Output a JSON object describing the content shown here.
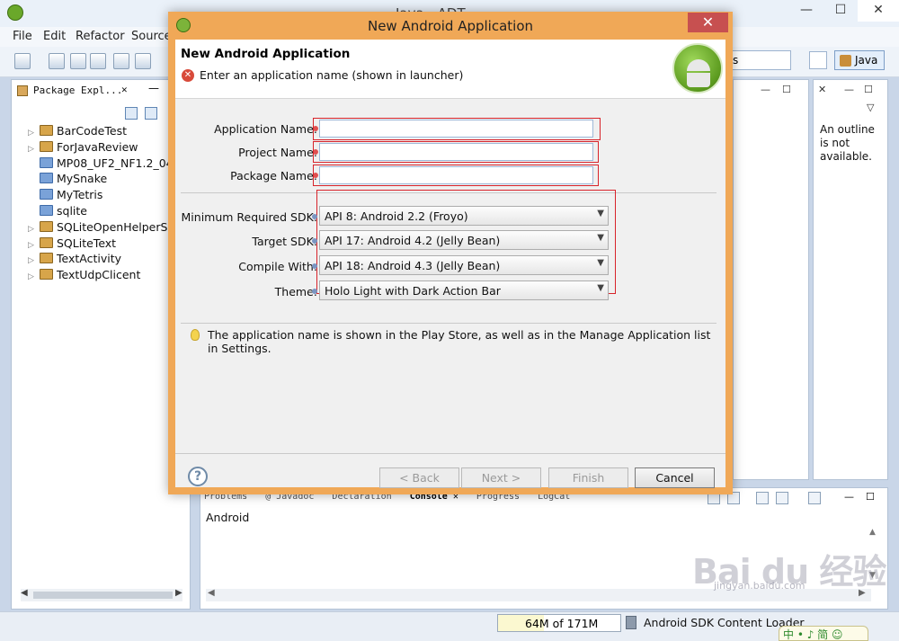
{
  "ide": {
    "title": "Java - ADT",
    "menu": [
      "File",
      "Edit",
      "Refactor",
      "Source"
    ],
    "search_value": "s",
    "perspective": "Java",
    "controls": {
      "minimize": "—",
      "maximize": "☐",
      "close": "✕"
    }
  },
  "package_explorer": {
    "tab_label": "Package Expl...",
    "close": "✕",
    "minimize": "—",
    "items": [
      {
        "label": "BarCodeTest",
        "expandable": true,
        "type": "android"
      },
      {
        "label": "ForJavaReview",
        "expandable": true,
        "type": "android"
      },
      {
        "label": "MP08_UF2_NF1.2_04",
        "expandable": false,
        "type": "folder"
      },
      {
        "label": "MySnake",
        "expandable": false,
        "type": "folder"
      },
      {
        "label": "MyTetris",
        "expandable": false,
        "type": "folder"
      },
      {
        "label": "sqlite",
        "expandable": false,
        "type": "folder"
      },
      {
        "label": "SQLiteOpenHelperSar",
        "expandable": true,
        "type": "android"
      },
      {
        "label": "SQLiteText",
        "expandable": true,
        "type": "android"
      },
      {
        "label": "TextActivity",
        "expandable": true,
        "type": "android"
      },
      {
        "label": "TextUdpClicent",
        "expandable": true,
        "type": "android"
      }
    ]
  },
  "outline": {
    "close": "✕",
    "minimize": "—",
    "maximize": "☐",
    "menu": "▽",
    "message": "An outline is not available."
  },
  "editor_controls": {
    "minimize": "—",
    "maximize": "☐"
  },
  "console": {
    "tabs": [
      "Problems",
      "@ Javadoc",
      "Declaration",
      "Console ✕",
      "Progress",
      "LogCat"
    ],
    "active_tab": "Console ✕",
    "label": "Android",
    "scroll_up": "▲",
    "scroll_down": "▼",
    "scroll_left": "◀",
    "scroll_right": "▶",
    "minimize": "—",
    "maximize": "☐"
  },
  "status": {
    "heap": "64M of 171M",
    "heap_used_fraction": 0.374,
    "task": "Android SDK Content Loader",
    "ime": "中 • ♪ 简 ☺"
  },
  "watermark": {
    "brand": "Bai du 经验",
    "url": "jingyan.baidu.com"
  },
  "dialog": {
    "title": "New Android Application",
    "close": "✕",
    "heading": "New Android Application",
    "error_icon": "✕",
    "error_message": "Enter an application name (shown in launcher)",
    "fields": {
      "application_name": {
        "label": "Application Name:",
        "value": ""
      },
      "project_name": {
        "label": "Project Name:",
        "value": ""
      },
      "package_name": {
        "label": "Package Name:",
        "value": ""
      }
    },
    "selects": {
      "min_sdk": {
        "label": "Minimum Required SDK:",
        "value": "API 8: Android 2.2 (Froyo)"
      },
      "target_sdk": {
        "label": "Target SDK:",
        "value": "API 17: Android 4.2 (Jelly Bean)"
      },
      "compile_with": {
        "label": "Compile With:",
        "value": "API 18: Android 4.3 (Jelly Bean)"
      },
      "theme": {
        "label": "Theme:",
        "value": "Holo Light with Dark Action Bar"
      }
    },
    "hint": "The application name is shown in the Play Store, as well as in the Manage Application list in Settings.",
    "buttons": {
      "help": "?",
      "back": "< Back",
      "next": "Next >",
      "finish": "Finish",
      "cancel": "Cancel"
    },
    "arrow": "▼"
  },
  "colors": {
    "dialog_frame": "#f0a857",
    "required_outline": "#d8232a",
    "close_button": "#c75050"
  }
}
